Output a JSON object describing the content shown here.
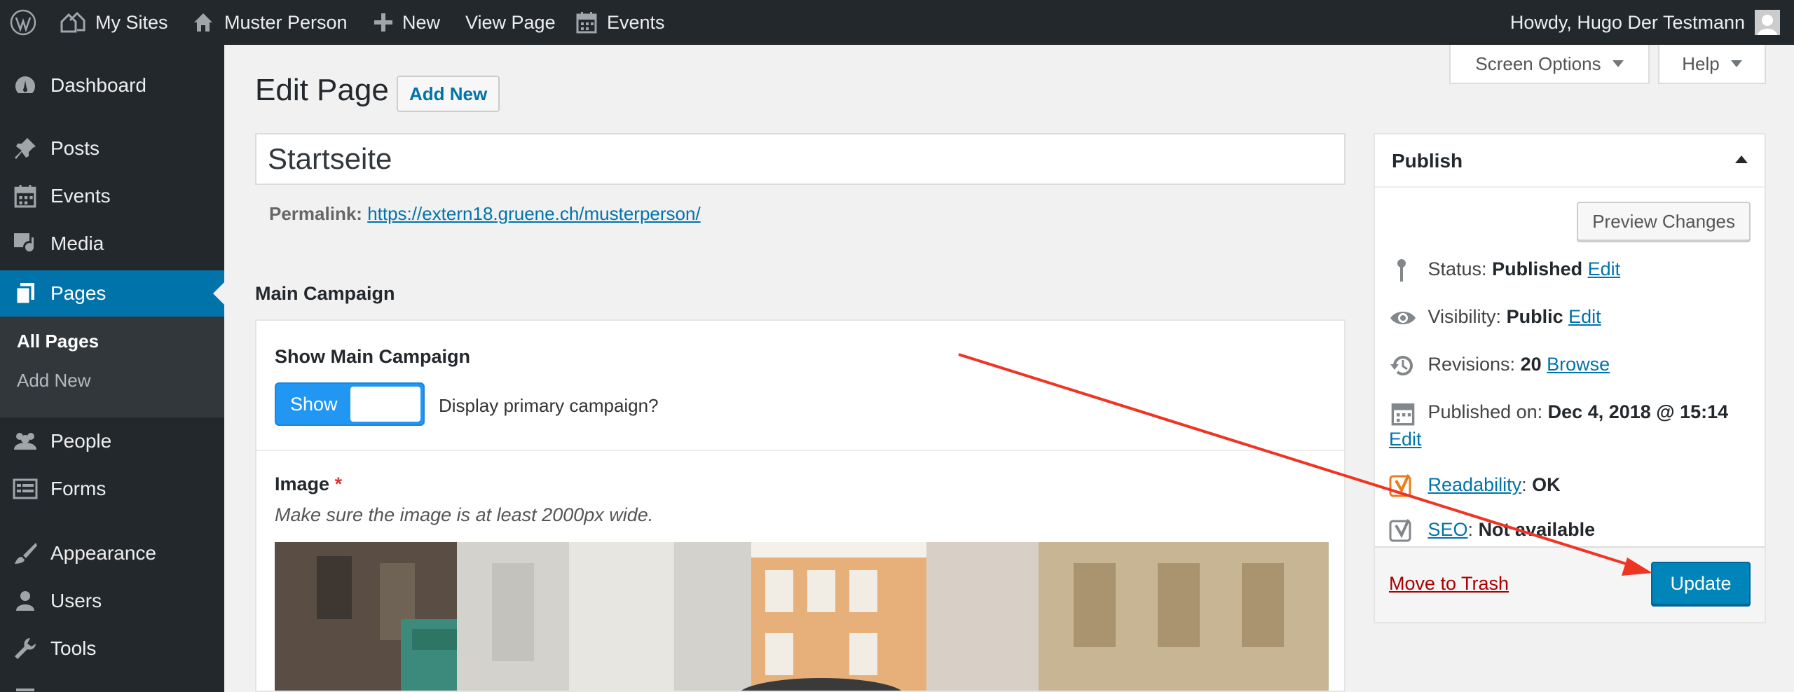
{
  "adminbar": {
    "my_sites": "My Sites",
    "site_name": "Muster Person",
    "new": "New",
    "view_page": "View Page",
    "events": "Events",
    "howdy": "Howdy, Hugo Der Testmann"
  },
  "sidebar": {
    "items": [
      {
        "label": "Dashboard",
        "icon": "dashboard-icon"
      },
      {
        "label": "Posts",
        "icon": "pin-icon"
      },
      {
        "label": "Events",
        "icon": "calendar-icon"
      },
      {
        "label": "Media",
        "icon": "media-icon"
      },
      {
        "label": "Pages",
        "icon": "pages-icon"
      },
      {
        "label": "People",
        "icon": "people-icon"
      },
      {
        "label": "Forms",
        "icon": "forms-icon"
      },
      {
        "label": "Appearance",
        "icon": "brush-icon"
      },
      {
        "label": "Users",
        "icon": "user-icon"
      },
      {
        "label": "Tools",
        "icon": "wrench-icon"
      }
    ],
    "submenu": [
      "All Pages",
      "Add New"
    ],
    "accent_color": "#0073aa"
  },
  "screen_options": "Screen Options",
  "help": "Help",
  "page": {
    "heading": "Edit Page",
    "add_new": "Add New",
    "title_value": "Startseite",
    "permalink_label": "Permalink:",
    "permalink_url": "https://extern18.gruene.ch/musterperson/"
  },
  "campaign": {
    "section_heading": "Main Campaign",
    "show_label": "Show Main Campaign",
    "toggle_text": "Show",
    "toggle_on": true,
    "question": "Display primary campaign?",
    "image_label": "Image",
    "required_mark": "*",
    "image_hint": "Make sure the image is at least 2000px wide."
  },
  "publish": {
    "title": "Publish",
    "preview": "Preview Changes",
    "status_label": "Status:",
    "status_value": "Published",
    "visibility_label": "Visibility:",
    "visibility_value": "Public",
    "revisions_label": "Revisions:",
    "revisions_value": "20",
    "browse": "Browse",
    "published_label": "Published on:",
    "published_value": "Dec 4, 2018 @ 15:14",
    "edit": "Edit",
    "readability_link": "Readability",
    "readability_value": "OK",
    "seo_link": "SEO",
    "seo_value": "Not available",
    "trash": "Move to Trash",
    "update": "Update",
    "update_color": "#0085ba"
  },
  "annotation": {
    "color": "#ee3524"
  }
}
